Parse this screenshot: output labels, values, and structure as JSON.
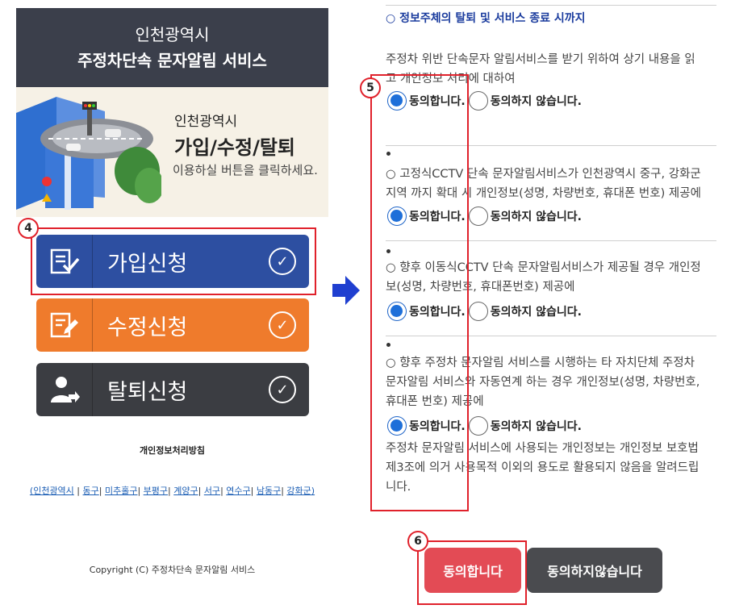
{
  "left": {
    "header_line1": "인천광역시",
    "header_line2": "주정차단속 문자알림 서비스",
    "banner_line1": "인천광역시",
    "banner_line2": "가입/수정/탈퇴",
    "banner_line3": "이용하실 버튼을 클릭하세요.",
    "buttons": [
      {
        "label": "가입신청",
        "icon": "form-check-icon",
        "color": "#2d4fa1"
      },
      {
        "label": "수정신청",
        "icon": "form-edit-icon",
        "color": "#ef7b2c"
      },
      {
        "label": "탈퇴신청",
        "icon": "user-leave-icon",
        "color": "#3b3d42"
      }
    ],
    "privacy_title": "개인정보처리방침",
    "region_links": [
      "(인천광역시",
      "동구",
      "미추홀구",
      "부평구",
      "계양구",
      "서구",
      "연수구",
      "남동구",
      "강화군)"
    ],
    "copyright": "Copyright (C) 주정차단속 문자알림 서비스"
  },
  "steps": {
    "left_badge": "4",
    "right_list_badge": "5",
    "right_button_badge": "6"
  },
  "right": {
    "heading": "○ 정보주체의 탈퇴 및 서비스 종료 시까지",
    "intro_line1": "주정차 위반 단속문자 알림서비스를 받기 위하여 상기 내용을 읽",
    "intro_line2": "고 개인정보 처리에 대하여",
    "agree_label": "동의합니다.",
    "disagree_label": "동의하지 않습니다.",
    "items": [
      {
        "line1": "○ 고정식CCTV 단속 문자알림서비스가 인천광역시 중구, 강화군",
        "line2": "지역 까지 확대 시 개인정보(성명, 차량번호, 휴대폰 번호) 제공에"
      },
      {
        "line1": "○ 향후 이동식CCTV 단속 문자알림서비스가 제공될 경우 개인정",
        "line2": "보(성명, 차량번호, 휴대폰번호) 제공에"
      },
      {
        "line1": "○ 향후 주정차 문자알림 서비스를 시행하는 타 자치단체 주정차",
        "line2": "문자알림 서비스와 자동연계 하는 경우 개인정보(성명, 차량번호,",
        "line3": "휴대폰 번호) 제공에"
      }
    ],
    "notice_line1": "주정차 문자알림 서비스에 사용되는 개인정보는 개인정보 보호법",
    "notice_line2": "제3조에 의거 사용목적 이외의 용도로 활용되지 않음을 알려드립",
    "notice_line3": "니다.",
    "agree_button": "동의합니다",
    "disagree_button": "동의하지않습니다"
  },
  "colors": {
    "accent_red": "#e0212b",
    "radio_blue": "#1e6fd9",
    "heading_blue": "#1b3c9e"
  }
}
